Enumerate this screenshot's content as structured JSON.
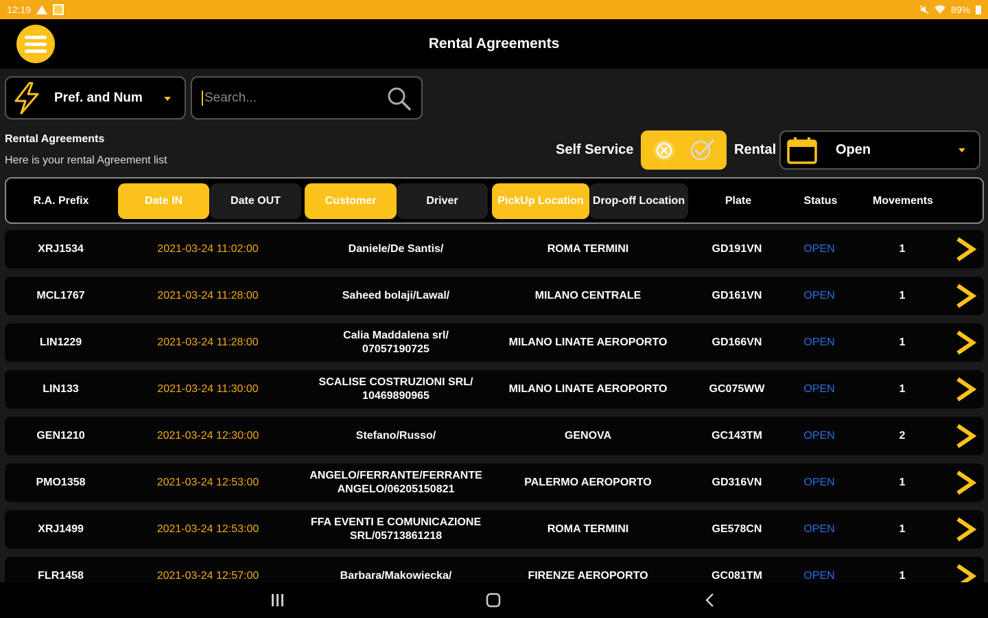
{
  "statusbar": {
    "time": "12:19",
    "battery": "89%"
  },
  "appbar": {
    "title": "Rental Agreements"
  },
  "filter": {
    "selected": "Pref. and Num"
  },
  "search": {
    "placeholder": "Search..."
  },
  "section": {
    "title": "Rental Agreements",
    "subtitle": "Here is your rental Agreement list"
  },
  "controls": {
    "self_service_label": "Self Service",
    "rental_label": "Rental",
    "rental_value": "Open"
  },
  "columns": [
    {
      "label": "R.A. Prefix",
      "active": false
    },
    {
      "label": "Date IN",
      "active": true
    },
    {
      "label": "Date OUT",
      "active": false
    },
    {
      "label": "Customer",
      "active": true
    },
    {
      "label": "Driver",
      "active": false
    },
    {
      "label": "PickUp Location",
      "active": true
    },
    {
      "label": "Drop-off Location",
      "active": false
    },
    {
      "label": "Plate",
      "active": false
    },
    {
      "label": "Status",
      "active": false
    },
    {
      "label": "Movements",
      "active": false
    }
  ],
  "rows": [
    {
      "prefix": "XRJ1534",
      "date": "2021-03-24 11:02:00",
      "customer": "Daniele/De Santis/",
      "location": "ROMA TERMINI",
      "plate": "GD191VN",
      "status": "OPEN",
      "movements": "1"
    },
    {
      "prefix": "MCL1767",
      "date": "2021-03-24 11:28:00",
      "customer": "Saheed bolaji/Lawal/",
      "location": "MILANO CENTRALE",
      "plate": "GD161VN",
      "status": "OPEN",
      "movements": "1"
    },
    {
      "prefix": "LIN1229",
      "date": "2021-03-24 11:28:00",
      "customer": "Calia Maddalena srl/ 07057190725",
      "location": "MILANO LINATE AEROPORTO",
      "plate": "GD166VN",
      "status": "OPEN",
      "movements": "1"
    },
    {
      "prefix": "LIN133",
      "date": "2021-03-24 11:30:00",
      "customer": "SCALISE COSTRUZIONI SRL/ 10469890965",
      "location": "MILANO LINATE AEROPORTO",
      "plate": "GC075WW",
      "status": "OPEN",
      "movements": "1"
    },
    {
      "prefix": "GEN1210",
      "date": "2021-03-24 12:30:00",
      "customer": "Stefano/Russo/",
      "location": "GENOVA",
      "plate": "GC143TM",
      "status": "OPEN",
      "movements": "2"
    },
    {
      "prefix": "PMO1358",
      "date": "2021-03-24 12:53:00",
      "customer": "ANGELO/FERRANTE/FERRANTE ANGELO/06205150821",
      "location": "PALERMO AEROPORTO",
      "plate": "GD316VN",
      "status": "OPEN",
      "movements": "1"
    },
    {
      "prefix": "XRJ1499",
      "date": "2021-03-24 12:53:00",
      "customer": "FFA EVENTI E COMUNICAZIONE SRL/05713861218",
      "location": "ROMA TERMINI",
      "plate": "GE578CN",
      "status": "OPEN",
      "movements": "1"
    },
    {
      "prefix": "FLR1458",
      "date": "2021-03-24 12:57:00",
      "customer": "Barbara/Makowiecka/",
      "location": "FIRENZE AEROPORTO",
      "plate": "GC081TM",
      "status": "OPEN",
      "movements": "1"
    }
  ],
  "colors": {
    "accent": "#fcc21c",
    "statusbar": "#f5a915",
    "date_text": "#f5a915",
    "status_text": "#2a6ee0"
  },
  "icons": {
    "menu": "hamburger-icon",
    "filter": "lightning-icon",
    "search": "search-icon",
    "calendar": "calendar-icon",
    "row_action": "chevron-right-icon"
  }
}
